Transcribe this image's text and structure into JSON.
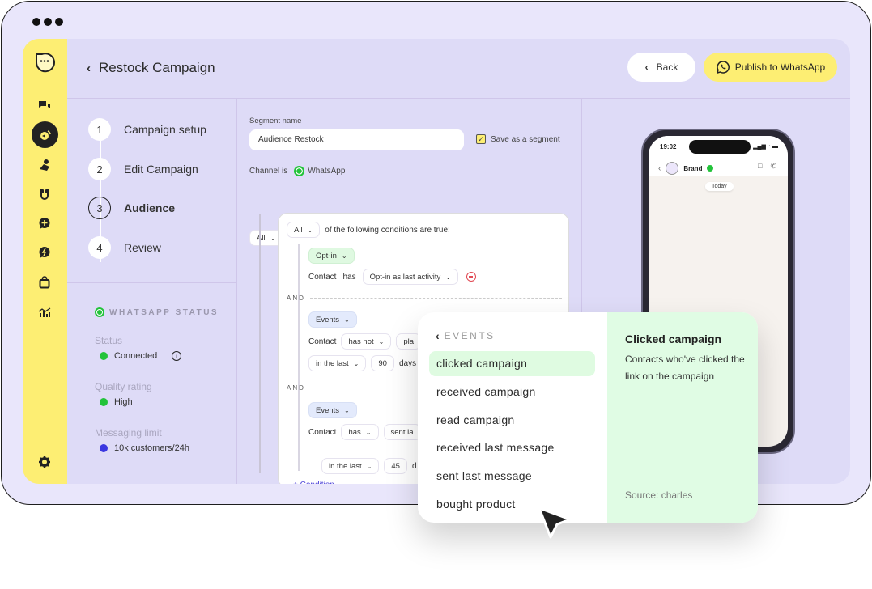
{
  "header": {
    "title": "Restock Campaign",
    "back_label": "Back",
    "publish_label": "Publish to WhatsApp"
  },
  "rail": {
    "icons": [
      "chats-icon",
      "campaigns-icon",
      "contacts-icon",
      "integrations-icon",
      "add-chat-icon",
      "automation-icon",
      "shop-icon",
      "analytics-icon",
      "settings-icon"
    ],
    "active": "campaigns-icon"
  },
  "steps": [
    {
      "num": "1",
      "label": "Campaign setup"
    },
    {
      "num": "2",
      "label": "Edit Campaign"
    },
    {
      "num": "3",
      "label": "Audience"
    },
    {
      "num": "4",
      "label": "Review"
    }
  ],
  "active_step": 3,
  "whatsapp_status": {
    "heading": "WHATSAPP STATUS",
    "status_label": "Status",
    "status_value": "Connected",
    "quality_label": "Quality rating",
    "quality_value": "High",
    "limit_label": "Messaging limit",
    "limit_value": "10k customers/24h",
    "colors": {
      "connected": "#22c33a",
      "high": "#22c33a",
      "limit": "#3a37e0"
    }
  },
  "segment": {
    "name_label": "Segment name",
    "name_value": "Audience Restock",
    "save_label": "Save as a segment",
    "save_checked": true,
    "channel_prefix": "Channel is",
    "channel": "WhatsApp",
    "outer_match": "All",
    "conditions_text": "of the following conditions are true:"
  },
  "group": {
    "match": "All",
    "conditions_text": "of the following conditions are true:",
    "and_label": "AND",
    "cond1": {
      "type": "Opt-in",
      "subject": "Contact",
      "verb": "has",
      "value": "Opt-in as last activity"
    },
    "cond2": {
      "type": "Events",
      "subject": "Contact",
      "verb": "has not",
      "value": "pla",
      "range": "in the last",
      "amount": "90",
      "unit": "days"
    },
    "cond3": {
      "type": "Events",
      "subject": "Contact",
      "verb": "has",
      "value": "sent la",
      "range": "in the last",
      "amount": "45",
      "unit": "d"
    },
    "add_condition": "+ Condition"
  },
  "phone": {
    "time": "19:02",
    "contact": "Brand",
    "date_chip": "Today",
    "signal": "▂▄▆ ◔ ▬"
  },
  "events_popup": {
    "heading": "EVENTS",
    "items": [
      "clicked campaign",
      "received campaign",
      "read campaign",
      "received last message",
      "sent last message",
      "bought product"
    ],
    "selected": "clicked campaign",
    "detail_title": "Clicked campaign",
    "detail_desc": "Contacts who've clicked the link on the campaign",
    "detail_source": "Source: charles"
  }
}
